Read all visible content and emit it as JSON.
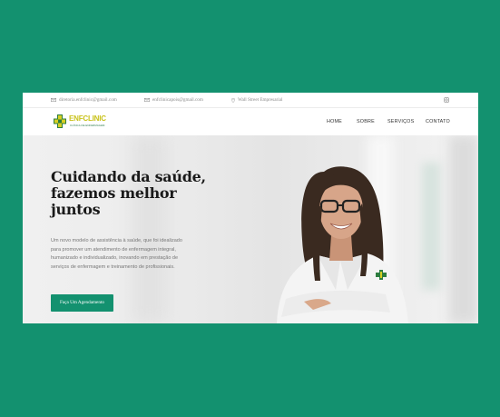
{
  "topbar": {
    "email1": "diretoria.enfclinic@gmail.com",
    "email2": "enfclinicapois@gmail.com",
    "address": "Wall Street Empresarial"
  },
  "brand": {
    "name": "ENFCLINIC",
    "tagline": "CLÍNICA DE ENFERMAGEM"
  },
  "nav": {
    "items": [
      "HOME",
      "SOBRE",
      "SERVIÇOS",
      "CONTATO"
    ]
  },
  "hero": {
    "headline_lines": [
      "Cuidando da saúde,",
      "fazemos melhor",
      "juntos"
    ],
    "paragraph_lines": [
      "Um novo modelo de assistência à saúde, que foi idealizado",
      "para promover um atendimento de enfermagem integral,",
      "humanizado e individualizado, inovando em prestação de",
      "serviços de enfermagem e treinamento de profissionais."
    ],
    "cta_label": "Faça Um Agendamento"
  },
  "colors": {
    "background": "#13916f",
    "accent": "#13916f",
    "logo_yellow": "#c9c21a"
  }
}
